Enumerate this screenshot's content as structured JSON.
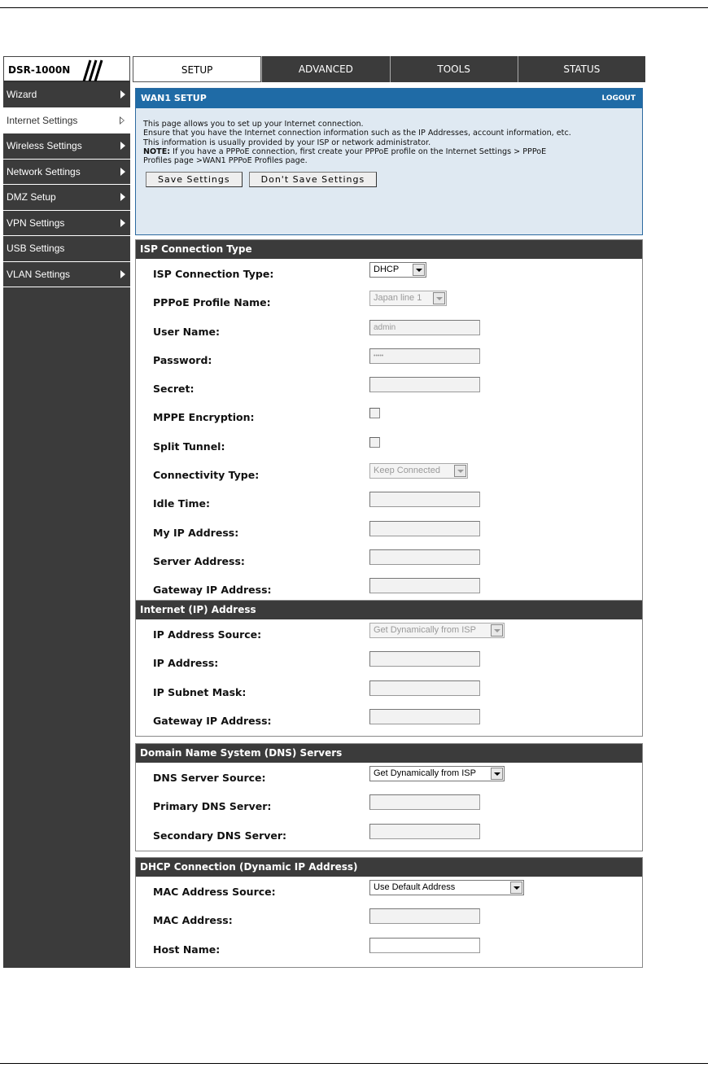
{
  "brand": {
    "model": "DSR-1000N"
  },
  "tabs": [
    "SETUP",
    "ADVANCED",
    "TOOLS",
    "STATUS"
  ],
  "sidebar": {
    "items": [
      {
        "label": "Wizard"
      },
      {
        "label": "Internet Settings"
      },
      {
        "label": "Wireless Settings"
      },
      {
        "label": "Network Settings"
      },
      {
        "label": "DMZ Setup"
      },
      {
        "label": "VPN Settings"
      },
      {
        "label": "USB Settings"
      },
      {
        "label": "VLAN Settings"
      }
    ]
  },
  "wan": {
    "title": "WAN1 SETUP",
    "logout": "LOGOUT",
    "line1": "This page allows you to set up your Internet connection.",
    "line2": "Ensure that you have the Internet connection information such as the IP Addresses, account information, etc.",
    "line3": "This information is usually provided by your ISP or network administrator.",
    "note_label": "NOTE:",
    "note_text": " If you have a PPPoE connection, first create your PPPoE profile on the Internet Settings > PPPoE",
    "note_text2": "Profiles page >WAN1 PPPoE Profiles page.",
    "save": "Save Settings",
    "dont_save": "Don't Save Settings"
  },
  "isp": {
    "title": "ISP Connection Type",
    "labels": {
      "connection_type": "ISP Connection Type:",
      "pppoe_profile": "PPPoE Profile Name:",
      "user_name": "User Name:",
      "password": "Password:",
      "secret": "Secret:",
      "mppe": "MPPE Encryption:",
      "split_tunnel": "Split Tunnel:",
      "connectivity_type": "Connectivity Type:",
      "idle_time": "Idle Time:",
      "my_ip": "My IP Address:",
      "server_address": "Server Address:",
      "gateway_ip": "Gateway IP Address:"
    },
    "values": {
      "connection_type": "DHCP",
      "pppoe_profile": "Japan line 1",
      "user_name": "admin",
      "password": "•••••",
      "connectivity_type": "Keep Connected"
    }
  },
  "internet_ip": {
    "title": "Internet (IP) Address",
    "labels": {
      "source": "IP Address Source:",
      "ip": "IP Address:",
      "mask": "IP Subnet Mask:",
      "gateway": "Gateway IP Address:"
    },
    "values": {
      "source": "Get Dynamically from ISP"
    }
  },
  "dns": {
    "title": "Domain Name System (DNS) Servers",
    "labels": {
      "source": "DNS Server Source:",
      "primary": "Primary DNS Server:",
      "secondary": "Secondary DNS Server:"
    },
    "values": {
      "source": "Get Dynamically from ISP"
    }
  },
  "dhcp": {
    "title": "DHCP Connection (Dynamic IP Address)",
    "labels": {
      "mac_source": "MAC Address Source:",
      "mac": "MAC Address:",
      "host": "Host Name:"
    },
    "values": {
      "mac_source": "Use Default Address"
    }
  }
}
